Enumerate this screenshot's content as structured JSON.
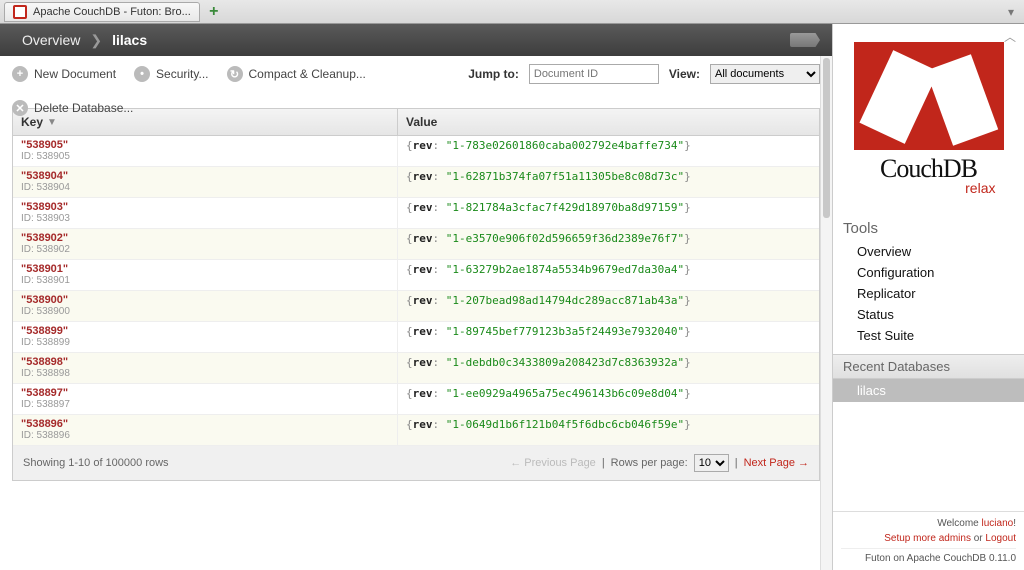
{
  "browser": {
    "tab_title": "Apache CouchDB - Futon: Bro..."
  },
  "breadcrumb": {
    "overview": "Overview",
    "current": "lilacs"
  },
  "toolbar": {
    "new_document": "New Document",
    "security": "Security...",
    "compact": "Compact & Cleanup...",
    "delete_db": "Delete Database...",
    "jump_to_label": "Jump to:",
    "jump_to_placeholder": "Document ID",
    "view_label": "View:",
    "view_selected": "All documents"
  },
  "table": {
    "header_key": "Key",
    "header_value": "Value",
    "rows": [
      {
        "key": "538905",
        "id": "538905",
        "rev": "1-783e02601860caba002792e4baffe734"
      },
      {
        "key": "538904",
        "id": "538904",
        "rev": "1-62871b374fa07f51a11305be8c08d73c"
      },
      {
        "key": "538903",
        "id": "538903",
        "rev": "1-821784a3cfac7f429d18970ba8d97159"
      },
      {
        "key": "538902",
        "id": "538902",
        "rev": "1-e3570e906f02d596659f36d2389e76f7"
      },
      {
        "key": "538901",
        "id": "538901",
        "rev": "1-63279b2ae1874a5534b9679ed7da30a4"
      },
      {
        "key": "538900",
        "id": "538900",
        "rev": "1-207bead98ad14794dc289acc871ab43a"
      },
      {
        "key": "538899",
        "id": "538899",
        "rev": "1-89745bef779123b3a5f24493e7932040"
      },
      {
        "key": "538898",
        "id": "538898",
        "rev": "1-debdb0c3433809a208423d7c8363932a"
      },
      {
        "key": "538897",
        "id": "538897",
        "rev": "1-ee0929a4965a75ec496143b6c09e8d04"
      },
      {
        "key": "538896",
        "id": "538896",
        "rev": "1-0649d1b6f121b04f5f6dbc6cb046f59e"
      }
    ]
  },
  "pager": {
    "status": "Showing 1-10 of 100000 rows",
    "prev": "← Previous Page",
    "rows_per_page_label": "Rows per page:",
    "rows_per_page_value": "10",
    "next": "Next Page →"
  },
  "sidebar": {
    "logo_name": "CouchDB",
    "logo_relax": "relax",
    "tools_title": "Tools",
    "tools": [
      "Overview",
      "Configuration",
      "Replicator",
      "Status",
      "Test Suite"
    ],
    "recent_title": "Recent Databases",
    "recent": [
      "lilacs"
    ]
  },
  "footer": {
    "welcome_prefix": "Welcome ",
    "user": "luciano",
    "welcome_suffix": "!",
    "setup_admins": "Setup more admins",
    "or": " or ",
    "logout": "Logout",
    "version_line": "Futon on Apache CouchDB 0.11.0"
  }
}
